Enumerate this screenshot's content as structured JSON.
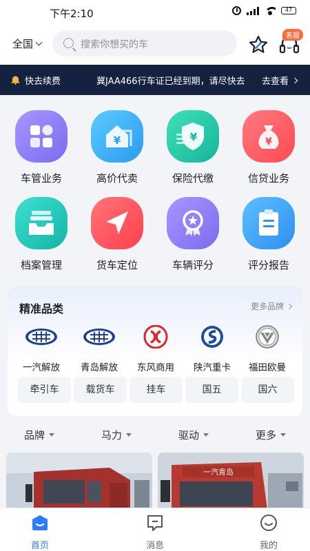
{
  "status_bar": {
    "time": "下午2:10",
    "battery": "47"
  },
  "header": {
    "region": "全国",
    "search_placeholder": "搜索你想买的车",
    "service_badge": "客服"
  },
  "notice": {
    "label": "快去续费",
    "message": "冀JAA466行车证已经到期，请尽快去",
    "action": "去查看"
  },
  "services": [
    {
      "label": "车管业务",
      "icon": "grid-apps-icon",
      "color": "#8a7cf5"
    },
    {
      "label": "高价代卖",
      "icon": "price-house-icon",
      "color": "#36b4f5"
    },
    {
      "label": "保险代缴",
      "icon": "insurance-shield-icon",
      "color": "#1fc6a4"
    },
    {
      "label": "信贷业务",
      "icon": "money-bag-icon",
      "color": "#ff5a5f"
    },
    {
      "label": "档案管理",
      "icon": "archive-tray-icon",
      "color": "#1fc6b6"
    },
    {
      "label": "货车定位",
      "icon": "location-arrow-icon",
      "color": "#ff4e55"
    },
    {
      "label": "车辆评分",
      "icon": "award-badge-icon",
      "color": "#8a7cf5"
    },
    {
      "label": "评分报告",
      "icon": "report-clipboard-icon",
      "color": "#3aa6f7"
    }
  ],
  "category": {
    "title": "精准品类",
    "more": "更多品牌",
    "brands": [
      {
        "name": "一汽解放",
        "logo": "faw-logo-icon"
      },
      {
        "name": "青岛解放",
        "logo": "faw-logo-icon"
      },
      {
        "name": "东风商用",
        "logo": "dongfeng-logo-icon"
      },
      {
        "name": "陕汽重卡",
        "logo": "shacman-logo-icon"
      },
      {
        "name": "福田欧曼",
        "logo": "foton-logo-icon"
      }
    ],
    "tags": [
      "牵引车",
      "载货车",
      "挂车",
      "国五",
      "国六"
    ]
  },
  "filters": [
    "品牌",
    "马力",
    "驱动",
    "更多"
  ],
  "bottom_nav": [
    {
      "label": "首页",
      "active": true
    },
    {
      "label": "消息",
      "active": false
    },
    {
      "label": "我的",
      "active": false
    }
  ],
  "colors": {
    "accent": "#2f7bff",
    "notice_bg": "#14213f",
    "badge": "#ff6a3c"
  }
}
